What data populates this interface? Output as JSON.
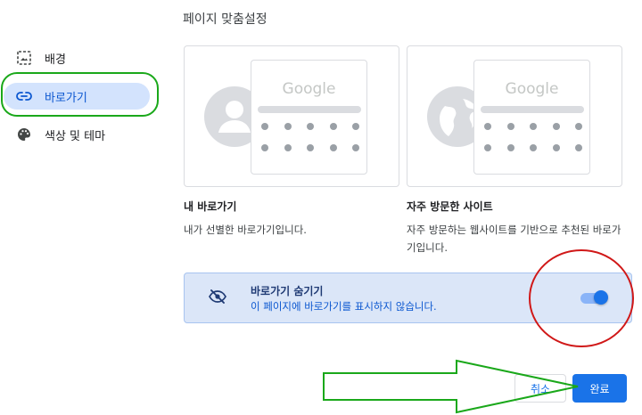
{
  "dialog": {
    "title": "페이지 맞춤설정"
  },
  "sidebar": {
    "items": [
      {
        "label": "배경",
        "icon": "image-icon",
        "active": false
      },
      {
        "label": "바로가기",
        "icon": "link-icon",
        "active": true
      },
      {
        "label": "색상 및 테마",
        "icon": "palette-icon",
        "active": false
      }
    ]
  },
  "options": [
    {
      "title": "내 바로가기",
      "description": "내가 선별한 바로가기입니다.",
      "preview_logo": "Google"
    },
    {
      "title": "자주 방문한 사이트",
      "description": "자주 방문하는 웹사이트를 기반으로 추천된 바로가기입니다.",
      "preview_logo": "Google"
    }
  ],
  "hide_shortcuts": {
    "title": "바로가기 숨기기",
    "description": "이 페이지에 바로가기를 표시하지 않습니다.",
    "toggle_on": true
  },
  "footer": {
    "cancel_label": "취소",
    "done_label": "완료"
  },
  "colors": {
    "accent": "#1a73e8",
    "active_nav_bg": "#d3e3fd",
    "highlight_row_bg": "#dbe6f8",
    "annotation_green": "#1aa81a",
    "annotation_red": "#d01818"
  }
}
